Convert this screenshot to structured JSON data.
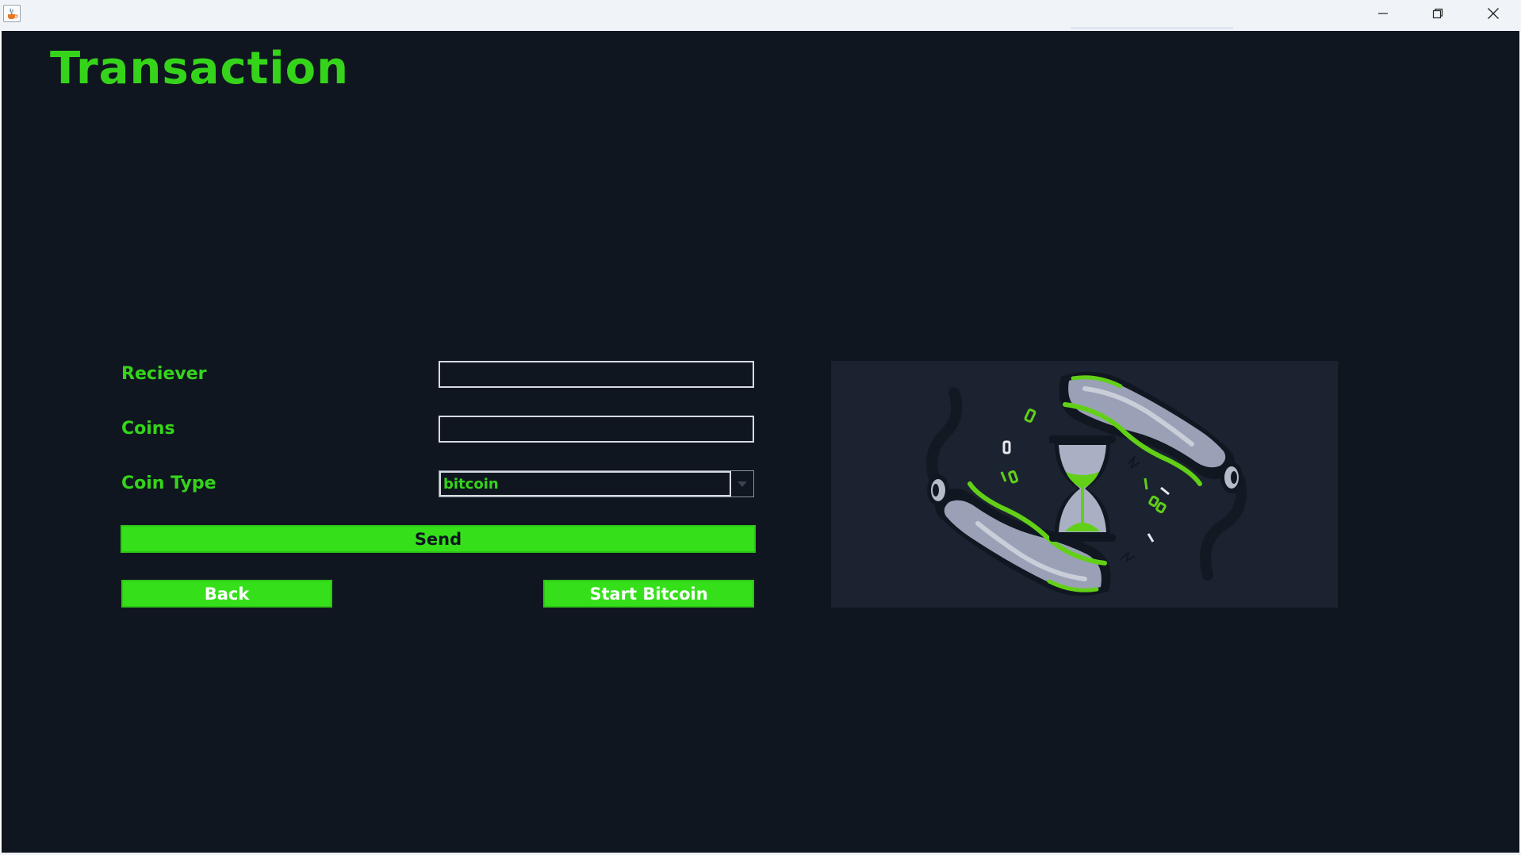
{
  "window": {
    "title": "",
    "icon": "java-cup-icon",
    "controls": {
      "minimize": "minimize-icon",
      "maximize": "restore-icon",
      "close": "close-icon"
    }
  },
  "page": {
    "title": "Transaction"
  },
  "form": {
    "receiver": {
      "label": "Reciever",
      "value": ""
    },
    "coins": {
      "label": "Coins",
      "value": ""
    },
    "coin_type": {
      "label": "Coin Type",
      "selected": "bitcoin"
    }
  },
  "buttons": {
    "send": "Send",
    "back": "Back",
    "start_bitcoin": "Start Bitcoin"
  },
  "illustration": {
    "name": "hands-hourglass-illustration"
  },
  "colors": {
    "background": "#0f1620",
    "accent": "#35d41a",
    "button": "#35e01a",
    "panel": "#1b2331"
  }
}
